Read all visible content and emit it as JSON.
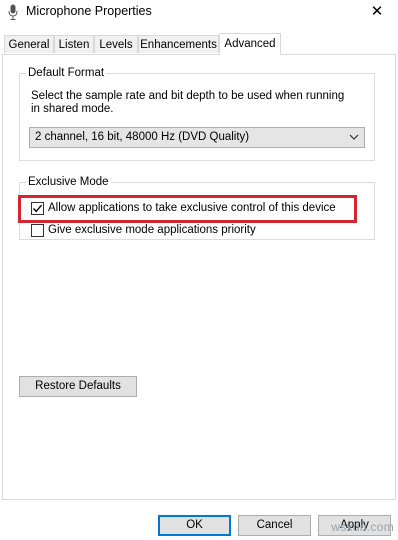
{
  "window": {
    "title": "Microphone Properties",
    "close_glyph": "✕"
  },
  "tabs": [
    {
      "label": "General"
    },
    {
      "label": "Listen"
    },
    {
      "label": "Levels"
    },
    {
      "label": "Enhancements"
    },
    {
      "label": "Advanced",
      "active": true
    }
  ],
  "default_format": {
    "group_label": "Default Format",
    "description_line1": "Select the sample rate and bit depth to be used when running",
    "description_line2": "in shared mode.",
    "selected_value": "2 channel, 16 bit, 48000 Hz (DVD Quality)"
  },
  "exclusive_mode": {
    "group_label": "Exclusive Mode",
    "allow_exclusive_label": "Allow applications to take exclusive control of this device",
    "allow_exclusive_checked": true,
    "priority_label": "Give exclusive mode applications priority",
    "priority_checked": false
  },
  "buttons": {
    "restore_defaults": "Restore Defaults",
    "ok": "OK",
    "cancel": "Cancel",
    "apply": "Apply"
  },
  "watermark": "wsxdn.com",
  "colors": {
    "highlight": "#d22630",
    "primary_border": "#0078d7"
  }
}
